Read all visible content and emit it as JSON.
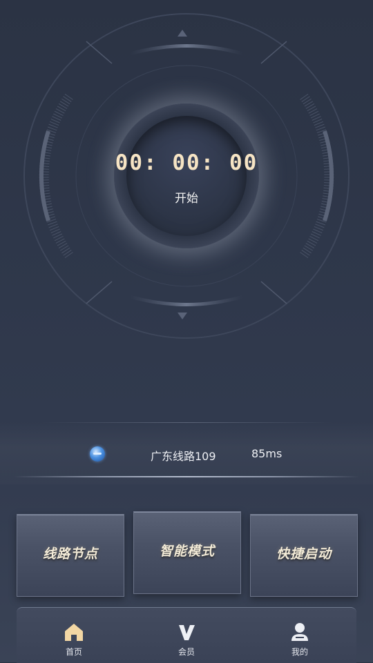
{
  "timer": {
    "display": "00: 00: 00",
    "start_label": "开始"
  },
  "route": {
    "icon": "globe-icon",
    "name": "广东线路109",
    "latency": "85ms"
  },
  "actions": [
    {
      "label": "线路节点"
    },
    {
      "label": "智能模式"
    },
    {
      "label": "快捷启动"
    }
  ],
  "tabs": [
    {
      "label": "首页",
      "icon": "home-icon",
      "active": true
    },
    {
      "label": "会员",
      "icon": "vip-icon",
      "active": false
    },
    {
      "label": "我的",
      "icon": "user-icon",
      "active": false
    }
  ],
  "colors": {
    "background": "#2f384b",
    "timer_text": "#f6e4c4",
    "home_icon_active": "#f3d7a4"
  }
}
